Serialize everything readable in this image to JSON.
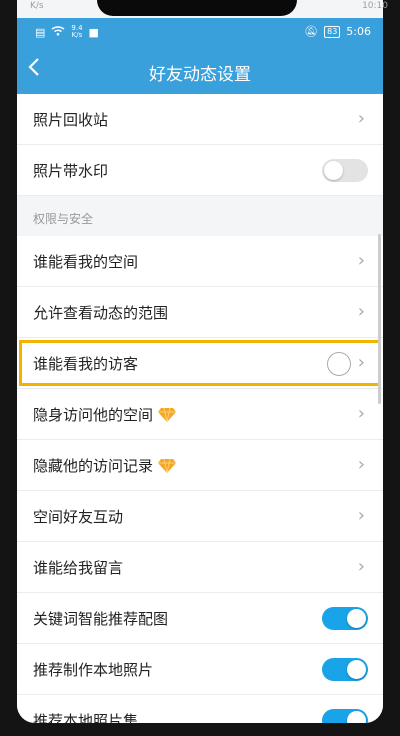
{
  "outer_status": {
    "left_text": "K/s",
    "right_text": "10:10"
  },
  "statusbar": {
    "net_speed": "9.4",
    "net_unit": "K/s",
    "battery": "83",
    "time": "5:06"
  },
  "navbar": {
    "back_icon": "chevron-left-icon",
    "title": "好友动态设置"
  },
  "rows_top": [
    {
      "label": "照片回收站",
      "control": "chevron"
    },
    {
      "label": "照片带水印",
      "control": "toggle",
      "on": false
    }
  ],
  "section": {
    "title": "权限与安全"
  },
  "rows_security": [
    {
      "label": "谁能看我的空间",
      "control": "chevron"
    },
    {
      "label": "允许查看动态的范围",
      "control": "chevron"
    },
    {
      "label": "谁能看我的访客",
      "control": "chevron",
      "highlighted": true
    },
    {
      "label": "隐身访问他的空间",
      "control": "chevron",
      "badge": "diamond-icon"
    },
    {
      "label": "隐藏他的访问记录",
      "control": "chevron",
      "badge": "diamond-icon"
    },
    {
      "label": "空间好友互动",
      "control": "chevron"
    },
    {
      "label": "谁能给我留言",
      "control": "chevron"
    },
    {
      "label": "关键词智能推荐配图",
      "control": "toggle",
      "on": true
    },
    {
      "label": "推荐制作本地照片",
      "control": "toggle",
      "on": true
    },
    {
      "label": "推荐本地照片集",
      "control": "toggle",
      "on": true
    }
  ],
  "colors": {
    "header_blue": "#3aa0dc",
    "toggle_on": "#19a3e8",
    "highlight": "#f2b400"
  }
}
